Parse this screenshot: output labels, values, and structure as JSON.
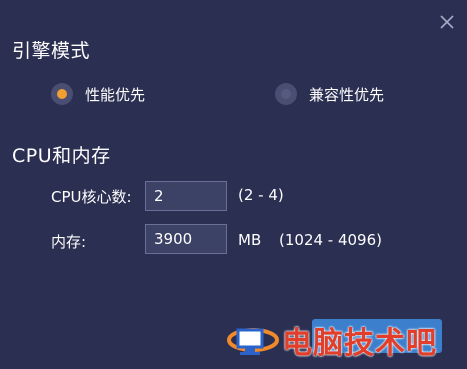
{
  "dialog": {
    "close_icon": "close-icon"
  },
  "engine": {
    "title": "引擎模式",
    "options": [
      {
        "label": "性能优先",
        "selected": true
      },
      {
        "label": "兼容性优先",
        "selected": false
      }
    ],
    "accent_color": "#f0a030"
  },
  "resources": {
    "title": "CPU和内存",
    "cpu": {
      "label": "CPU核心数:",
      "value": "2",
      "range": "(2 - 4)"
    },
    "memory": {
      "label": "内存:",
      "value": "3900",
      "unit": "MB",
      "range": "(1024 - 4096)"
    }
  },
  "watermark": {
    "text": "电脑技术吧"
  }
}
